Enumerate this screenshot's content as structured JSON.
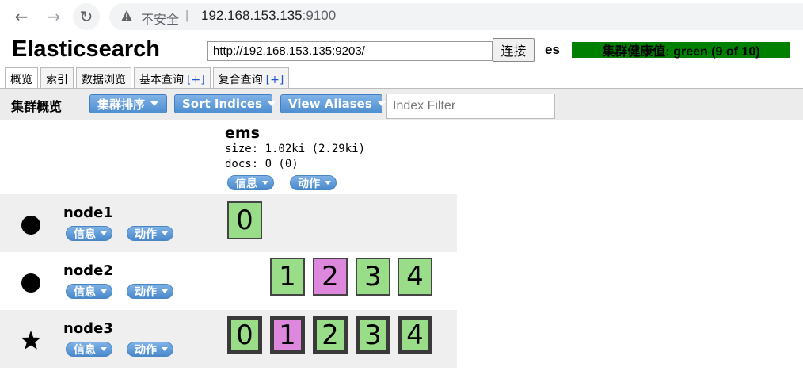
{
  "browser": {
    "insecure_label": "不安全",
    "separator": "|",
    "url_host": "192.168.153.135",
    "url_port": ":9100"
  },
  "app": {
    "title": "Elasticsearch",
    "cluster_url": "http://192.168.153.135:9203/",
    "connect_label": "连接",
    "cluster_name": "es",
    "health": "集群健康值: green (9 of 10)",
    "health_color": "#008000"
  },
  "tabs": [
    {
      "label": "概览",
      "plus": ""
    },
    {
      "label": "索引",
      "plus": ""
    },
    {
      "label": "数据浏览",
      "plus": ""
    },
    {
      "label": "基本查询",
      "plus": "[+]"
    },
    {
      "label": "复合查询",
      "plus": "[+]"
    }
  ],
  "toolbar": {
    "title": "集群概览",
    "sort_cluster": "集群排序",
    "sort_indices": "Sort Indices",
    "view_aliases": "View Aliases",
    "filter_placeholder": "Index Filter"
  },
  "index": {
    "name": "ems",
    "size": "size: 1.02ki (2.29ki)",
    "docs": "docs: 0 (0)",
    "info_label": "信息",
    "action_label": "动作"
  },
  "nodes": [
    {
      "name": "node1",
      "icon": "circle-icon",
      "info_label": "信息",
      "action_label": "动作",
      "shards": [
        {
          "label": "0",
          "color": "green",
          "primary": false
        }
      ]
    },
    {
      "name": "node2",
      "icon": "circle-icon",
      "info_label": "信息",
      "action_label": "动作",
      "shards": [
        {
          "label": "1",
          "color": "green",
          "primary": false
        },
        {
          "label": "2",
          "color": "pink",
          "primary": false
        },
        {
          "label": "3",
          "color": "green",
          "primary": false
        },
        {
          "label": "4",
          "color": "green",
          "primary": false
        }
      ]
    },
    {
      "name": "node3",
      "icon": "star-icon",
      "info_label": "信息",
      "action_label": "动作",
      "shards": [
        {
          "label": "0",
          "color": "green",
          "primary": true
        },
        {
          "label": "1",
          "color": "pink",
          "primary": true
        },
        {
          "label": "2",
          "color": "green",
          "primary": true
        },
        {
          "label": "3",
          "color": "green",
          "primary": true
        },
        {
          "label": "4",
          "color": "green",
          "primary": true
        }
      ]
    }
  ],
  "colors": {
    "shard_green": "#99dd88",
    "shard_pink": "#dd88dd",
    "button_blue": "#4f8fd1"
  }
}
